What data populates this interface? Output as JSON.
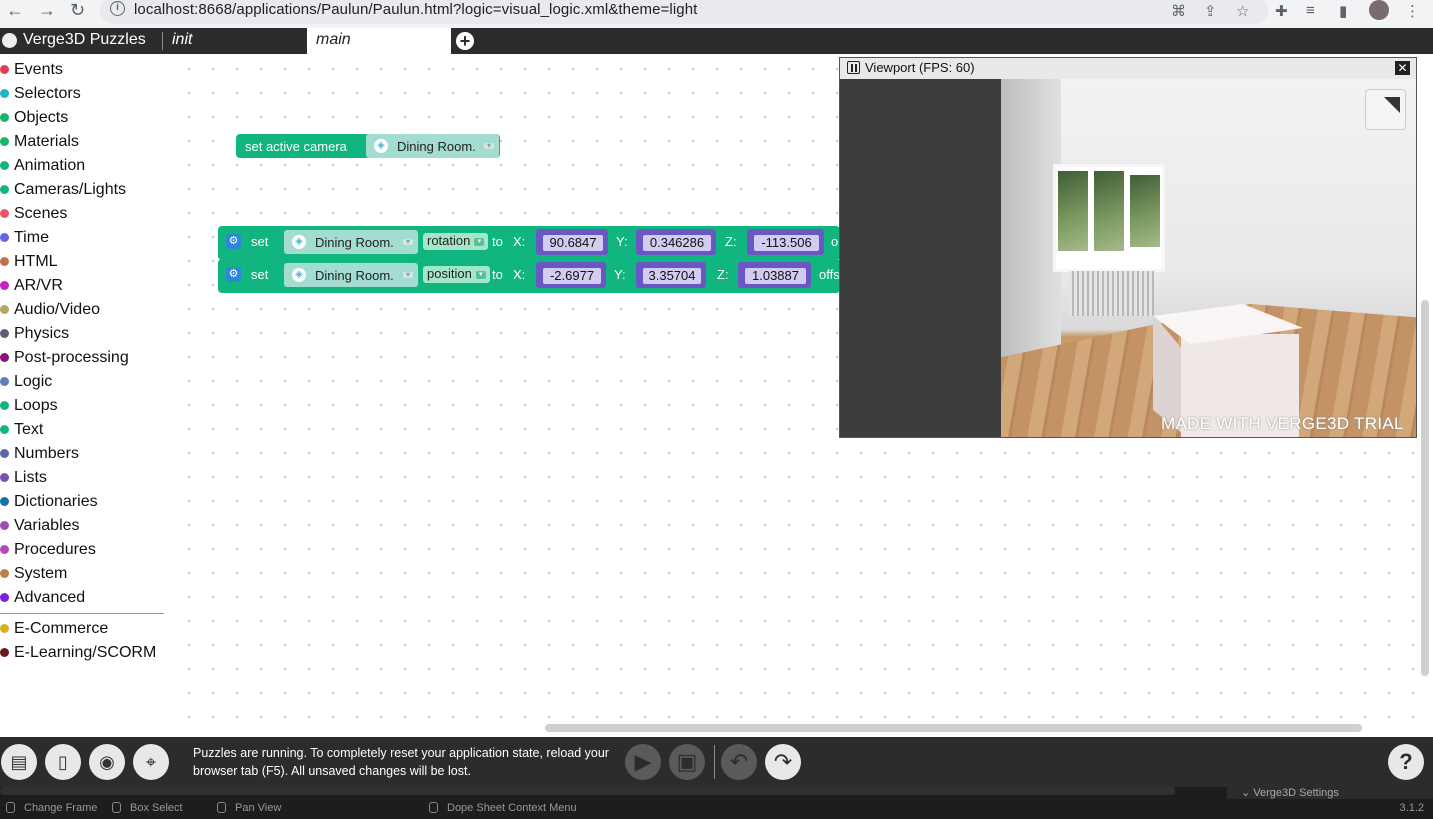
{
  "browser": {
    "url": "localhost:8668/applications/Paulun/Paulun.html?logic=visual_logic.xml&theme=light"
  },
  "header": {
    "app_title": "Verge3D Puzzles",
    "tabs": [
      {
        "label": "init"
      },
      {
        "label": "main"
      }
    ]
  },
  "sidebar": {
    "categories": [
      {
        "label": "Events",
        "color": "#e03c55"
      },
      {
        "label": "Selectors",
        "color": "#1bb7c4"
      },
      {
        "label": "Objects",
        "color": "#18b56c"
      },
      {
        "label": "Materials",
        "color": "#18b56c"
      },
      {
        "label": "Animation",
        "color": "#12b580"
      },
      {
        "label": "Cameras/Lights",
        "color": "#12b580"
      },
      {
        "label": "Scenes",
        "color": "#ee5168"
      },
      {
        "label": "Time",
        "color": "#6464e6"
      },
      {
        "label": "HTML",
        "color": "#c0704b"
      },
      {
        "label": "AR/VR",
        "color": "#c51fc5"
      },
      {
        "label": "Audio/Video",
        "color": "#b2a95a"
      },
      {
        "label": "Physics",
        "color": "#5b6079"
      },
      {
        "label": "Post-processing",
        "color": "#86127a"
      },
      {
        "label": "Logic",
        "color": "#5b80b6"
      },
      {
        "label": "Loops",
        "color": "#12b580"
      },
      {
        "label": "Text",
        "color": "#12b580"
      },
      {
        "label": "Numbers",
        "color": "#5b67a5"
      },
      {
        "label": "Lists",
        "color": "#7a4fb5"
      },
      {
        "label": "Dictionaries",
        "color": "#1471a8"
      },
      {
        "label": "Variables",
        "color": "#9a4fb5"
      },
      {
        "label": "Procedures",
        "color": "#b84ab8"
      },
      {
        "label": "System",
        "color": "#b5834a"
      },
      {
        "label": "Advanced",
        "color": "#7a1fdd"
      }
    ],
    "extra_categories": [
      {
        "label": "E-Commerce",
        "color": "#d8b018"
      },
      {
        "label": "E-Learning/SCORM",
        "color": "#6d1818"
      }
    ]
  },
  "workspace": {
    "camera_block": {
      "label": "set active camera",
      "object": "Dining Room."
    },
    "rotation_block": {
      "set": "set",
      "object": "Dining Room.",
      "property": "rotation",
      "to": "to",
      "x_label": "X:",
      "x": "90.6847",
      "y_label": "Y:",
      "y": "0.346286",
      "z_label": "Z:",
      "z": "-113.506",
      "tail": "o"
    },
    "position_block": {
      "set": "set",
      "object": "Dining Room.",
      "property": "position",
      "to": "to",
      "x_label": "X:",
      "x": "-2.6977",
      "y_label": "Y:",
      "y": "3.35704",
      "z_label": "Z:",
      "z": "1.03887",
      "tail": "offs"
    }
  },
  "viewport": {
    "title": "Viewport (FPS: 60)",
    "watermark": "MADE WITH VERGE3D TRIAL"
  },
  "status": {
    "message": "Puzzles are running. To completely reset your application state, reload your browser tab (F5). All unsaved changes will be lost."
  },
  "blender": {
    "hints": [
      "Change Frame",
      "Box Select",
      "Pan View",
      "Dope Sheet Context Menu"
    ],
    "panel": "Verge3D Settings",
    "version": "3.1.2"
  }
}
